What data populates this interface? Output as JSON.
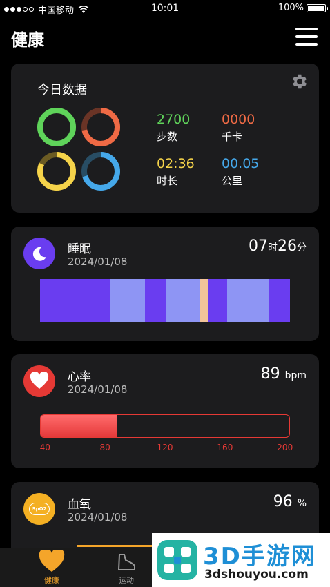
{
  "status_bar": {
    "carrier": "中国移动",
    "time": "10:01",
    "battery": "100%"
  },
  "header": {
    "title": "健康"
  },
  "today": {
    "title": "今日数据",
    "stats": [
      {
        "value": "2700",
        "label": "步数",
        "color": "#5fd35a"
      },
      {
        "value": "0000",
        "label": "千卡",
        "color": "#ef6a45"
      },
      {
        "value": "02:36",
        "label": "时长",
        "color": "#f5d34a"
      },
      {
        "value": "00.05",
        "label": "公里",
        "color": "#45a8ea"
      }
    ],
    "rings": [
      {
        "color": "#5fd35a",
        "track": "#2f5a2d",
        "progress": 1.0
      },
      {
        "color": "#ef6a45",
        "track": "#6a3426",
        "progress": 0.72
      },
      {
        "color": "#f5d34a",
        "track": "#6b5b23",
        "progress": 0.82
      },
      {
        "color": "#45a8ea",
        "track": "#284d64",
        "progress": 0.7
      }
    ]
  },
  "sleep": {
    "title": "睡眠",
    "date": "2024/01/08",
    "hours": "07",
    "hours_unit": "时",
    "minutes": "26",
    "minutes_unit": "分",
    "icon_color": "#6a3df0",
    "segments": [
      {
        "stage": "deep",
        "weight": 100,
        "color": "#6a3df0"
      },
      {
        "stage": "light",
        "weight": 50,
        "color": "#8e95f4"
      },
      {
        "stage": "deep",
        "weight": 30,
        "color": "#6a3df0"
      },
      {
        "stage": "light",
        "weight": 48,
        "color": "#8e95f4"
      },
      {
        "stage": "awake",
        "weight": 12,
        "color": "#f2c49a"
      },
      {
        "stage": "deep",
        "weight": 28,
        "color": "#6a3df0"
      },
      {
        "stage": "light",
        "weight": 60,
        "color": "#8e95f4"
      },
      {
        "stage": "deep",
        "weight": 30,
        "color": "#6a3df0"
      }
    ]
  },
  "heart": {
    "title": "心率",
    "date": "2024/01/08",
    "value": "89",
    "unit": "bpm",
    "icon_color": "#e53935",
    "min": 40,
    "max": 200,
    "current": 89,
    "ticks": [
      "40",
      "80",
      "120",
      "160",
      "200"
    ]
  },
  "spo2": {
    "title": "血氧",
    "date": "2024/01/08",
    "value": "96",
    "unit": "%",
    "icon_label": "SpO2",
    "icon_color": "#f4b023"
  },
  "tabs": [
    {
      "label": "健康",
      "icon": "heart-icon",
      "active": true
    },
    {
      "label": "运动",
      "icon": "shoe-icon",
      "active": false
    }
  ],
  "watermark": {
    "brand": "3D手游网",
    "url": "3dshouyou.com"
  }
}
